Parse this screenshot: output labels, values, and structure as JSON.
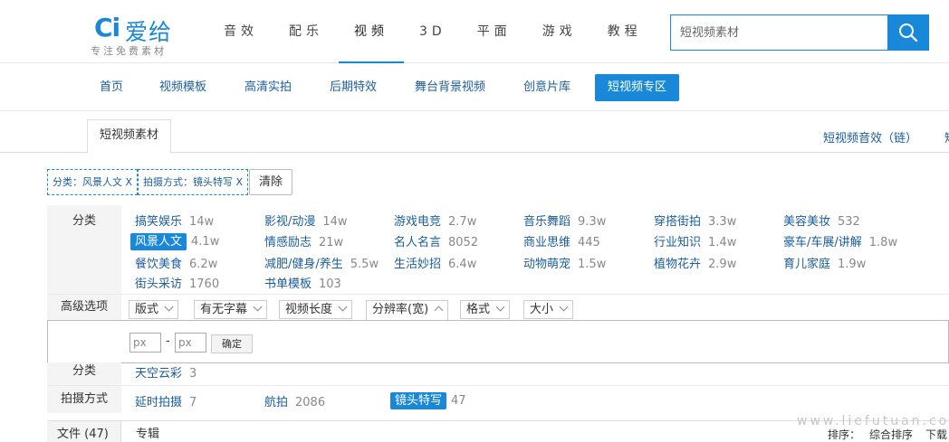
{
  "logo": {
    "mark": "Ci",
    "text": "爱给",
    "slogan": "专注免费素材"
  },
  "topnav": [
    "音效",
    "配乐",
    "视频",
    "3D",
    "平面",
    "游戏",
    "教程"
  ],
  "topnav_active": 2,
  "search": {
    "placeholder": "短视频素材",
    "icon": "search-icon"
  },
  "subnav": [
    "首页",
    "视频模板",
    "高清实拍",
    "后期特效",
    "舞台背景视频",
    "创意片库",
    "短视频专区"
  ],
  "subnav_active": 6,
  "tabs": {
    "active": "短视频素材",
    "right1": "短视频音效（链）",
    "right2": "短"
  },
  "selected_filters": [
    {
      "label": "分类：风景人文",
      "remove": "X"
    },
    {
      "label": "拍摄方式：镜头特写",
      "remove": "X"
    }
  ],
  "clear_label": "清除",
  "category": {
    "label": "分类",
    "items": [
      {
        "name": "搞笑娱乐",
        "count": "14w"
      },
      {
        "name": "影视/动漫",
        "count": "14w"
      },
      {
        "name": "游戏电竞",
        "count": "2.7w"
      },
      {
        "name": "音乐舞蹈",
        "count": "9.3w"
      },
      {
        "name": "穿搭街拍",
        "count": "3.3w"
      },
      {
        "name": "美容美妆",
        "count": "532"
      },
      {
        "name": "风景人文",
        "count": "4.1w"
      },
      {
        "name": "情感励志",
        "count": "21w"
      },
      {
        "name": "名人名言",
        "count": "8052"
      },
      {
        "name": "商业思维",
        "count": "445"
      },
      {
        "name": "行业知识",
        "count": "1.4w"
      },
      {
        "name": "豪车/车展/讲解",
        "count": "1.8w"
      },
      {
        "name": "餐饮美食",
        "count": "6.2w"
      },
      {
        "name": "减肥/健身/养生",
        "count": "5.5w"
      },
      {
        "name": "生活妙招",
        "count": "6.4w"
      },
      {
        "name": "动物萌宠",
        "count": "1.5w"
      },
      {
        "name": "植物花卉",
        "count": "2.9w"
      },
      {
        "name": "育儿家庭",
        "count": "1.9w"
      },
      {
        "name": "街头采访",
        "count": "1760"
      },
      {
        "name": "书单模板",
        "count": "103"
      }
    ],
    "selected_index": 6
  },
  "advanced": {
    "label": "高级选项",
    "dropdowns": [
      "版式",
      "有无字幕",
      "视频长度",
      "分辨率(宽)",
      "格式",
      "大小"
    ],
    "open_index": 3,
    "panel": {
      "from_placeholder": "px",
      "to_placeholder": "px",
      "separator": "-",
      "confirm": "确定"
    }
  },
  "subcategory": {
    "label": "分类",
    "items": [
      {
        "name": "天空云彩",
        "count": "3"
      }
    ]
  },
  "shooting": {
    "label": "拍摄方式",
    "items": [
      {
        "name": "延时拍摄",
        "count": "7"
      },
      {
        "name": "航拍",
        "count": "2086"
      },
      {
        "name": "镜头特写",
        "count": "47"
      }
    ],
    "selected_index": 2
  },
  "bottom": {
    "tab_active": "文件 (47)",
    "tab2": "专辑",
    "sort_label": "排序：",
    "sort_opts": [
      "综合排序",
      "下载"
    ]
  },
  "watermark": "www.liefutuan.com",
  "colors": {
    "accent": "#1a88d8",
    "link": "#1a5d9c"
  }
}
